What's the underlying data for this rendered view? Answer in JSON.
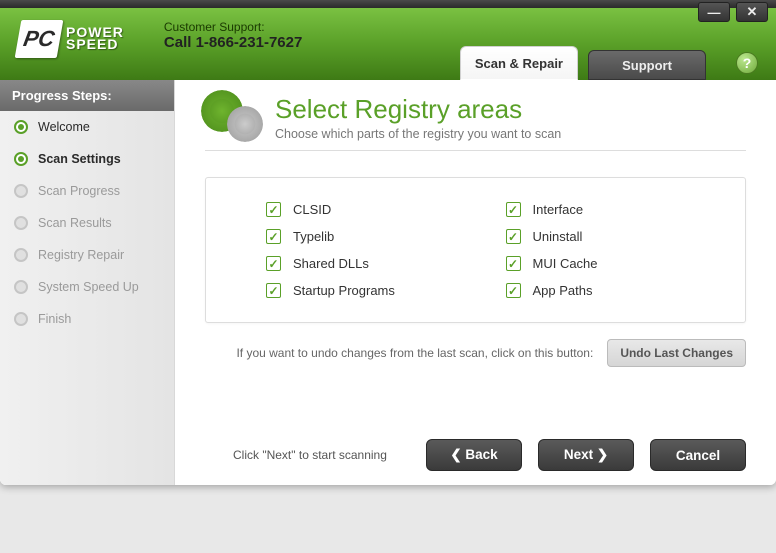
{
  "window": {
    "minimize": "—",
    "close": "✕"
  },
  "logo": {
    "badge": "PC",
    "line1": "POWER",
    "line2": "SPEED"
  },
  "support": {
    "label": "Customer Support:",
    "phone": "Call 1-866-231-7627"
  },
  "tabs": {
    "scan_repair": "Scan & Repair",
    "support": "Support"
  },
  "help": "?",
  "sidebar": {
    "title": "Progress Steps:",
    "steps": [
      {
        "label": "Welcome",
        "state": "done"
      },
      {
        "label": "Scan Settings",
        "state": "active"
      },
      {
        "label": "Scan Progress",
        "state": "pending"
      },
      {
        "label": "Scan Results",
        "state": "pending"
      },
      {
        "label": "Registry Repair",
        "state": "pending"
      },
      {
        "label": "System Speed Up",
        "state": "pending"
      },
      {
        "label": "Finish",
        "state": "pending"
      }
    ]
  },
  "main": {
    "title": "Select Registry areas",
    "subtitle": "Choose which parts of the registry you want to scan",
    "checks_left": [
      {
        "label": "CLSID",
        "checked": true
      },
      {
        "label": "Typelib",
        "checked": true
      },
      {
        "label": "Shared DLLs",
        "checked": true
      },
      {
        "label": "Startup Programs",
        "checked": true
      }
    ],
    "checks_right": [
      {
        "label": "Interface",
        "checked": true
      },
      {
        "label": "Uninstall",
        "checked": true
      },
      {
        "label": "MUI Cache",
        "checked": true
      },
      {
        "label": "App Paths",
        "checked": true
      }
    ],
    "undo_hint": "If you want to undo changes from the last scan, click on this button:",
    "undo_button": "Undo Last Changes",
    "next_hint": "Click \"Next\" to start scanning",
    "back": "❮ Back",
    "next": "Next ❯",
    "cancel": "Cancel"
  }
}
